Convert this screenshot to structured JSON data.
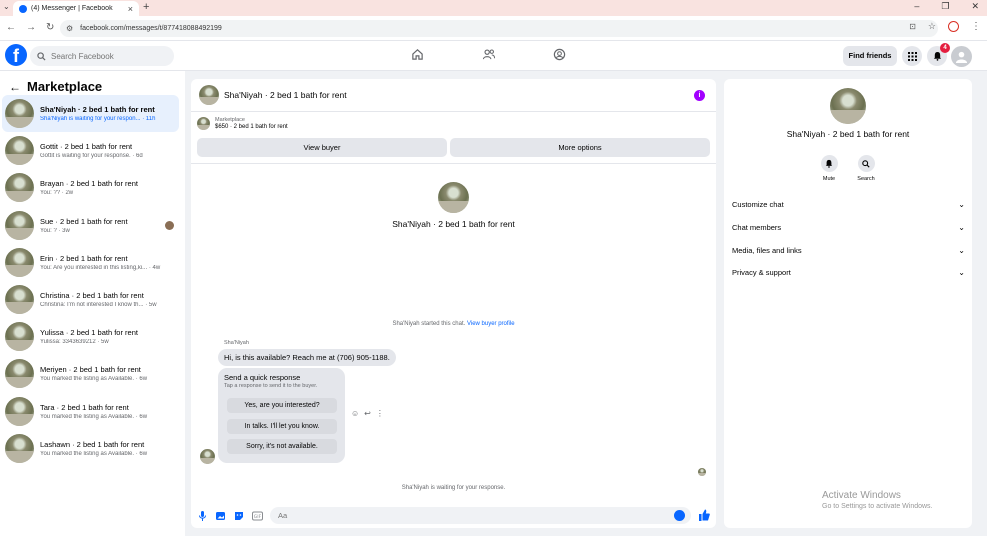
{
  "browser": {
    "tab_title": "(4) Messenger | Facebook",
    "url": "facebook.com/messages/t/877418088492199"
  },
  "fb": {
    "search_placeholder": "Search Facebook",
    "find_friends": "Find friends",
    "notification_count": "4"
  },
  "sidebar": {
    "title": "Marketplace",
    "items": [
      {
        "name": "Sha'Niyah · 2 bed 1 bath for rent",
        "preview": "Sha'Niyah is waiting for your respon... · 11h",
        "active": true
      },
      {
        "name": "Gottit · 2 bed 1 bath for rent",
        "preview": "Gottit is waiting for your response. · 6d"
      },
      {
        "name": "Brayan · 2 bed 1 bath for rent",
        "preview": "You: ?? · 2w"
      },
      {
        "name": "Sue · 2 bed 1 bath for rent",
        "preview": "You: ? · 3w"
      },
      {
        "name": "Erin · 2 bed 1 bath for rent",
        "preview": "You: Are you interested in this listing,ki... · 4w"
      },
      {
        "name": "Christina · 2 bed 1 bath for rent",
        "preview": "Christina: I'm not interested I know th... · 5w"
      },
      {
        "name": "Yulissa · 2 bed 1 bath for rent",
        "preview": "Yulissa: 3343639212 · 5w"
      },
      {
        "name": "Meriyen · 2 bed 1 bath for rent",
        "preview": "You marked the listing as Available. · 6w"
      },
      {
        "name": "Tara · 2 bed 1 bath for rent",
        "preview": "You marked the listing as Available. · 6w"
      },
      {
        "name": "Lashawn · 2 bed 1 bath for rent",
        "preview": "You marked the listing as Available. · 6w"
      }
    ]
  },
  "chat": {
    "title": "Sha'Niyah · 2 bed 1 bath for rent",
    "marketplace_label": "Marketplace",
    "price_line": "$650 · 2 bed 1 bath for rent",
    "view_buyer": "View buyer",
    "more_options": "More options",
    "center_name": "Sha'Niyah · 2 bed 1 bath for rent",
    "started_text": "Sha'Niyah started this chat.",
    "view_buyer_profile": "View buyer profile",
    "sender": "Sha'Niyah",
    "message": "Hi, is this available? Reach me at (706) 905-1188.",
    "quick_title": "Send a quick response",
    "quick_sub": "Tap a response to send it to the buyer.",
    "quick_options": [
      "Yes, are you interested?",
      "In talks. I'll let you know.",
      "Sorry, it's not available."
    ],
    "waiting_text": "Sha'Niyah is waiting for your response.",
    "composer_placeholder": "Aa"
  },
  "right": {
    "name": "Sha'Niyah · 2 bed 1 bath for rent",
    "mute": "Mute",
    "search": "Search",
    "sections": [
      "Customize chat",
      "Chat members",
      "Media, files and links",
      "Privacy & support"
    ]
  },
  "watermark": {
    "line1": "Activate Windows",
    "line2": "Go to Settings to activate Windows."
  },
  "colors": {
    "brand": "#0866ff",
    "info": "#a200ff",
    "badge": "#e41e3f"
  }
}
